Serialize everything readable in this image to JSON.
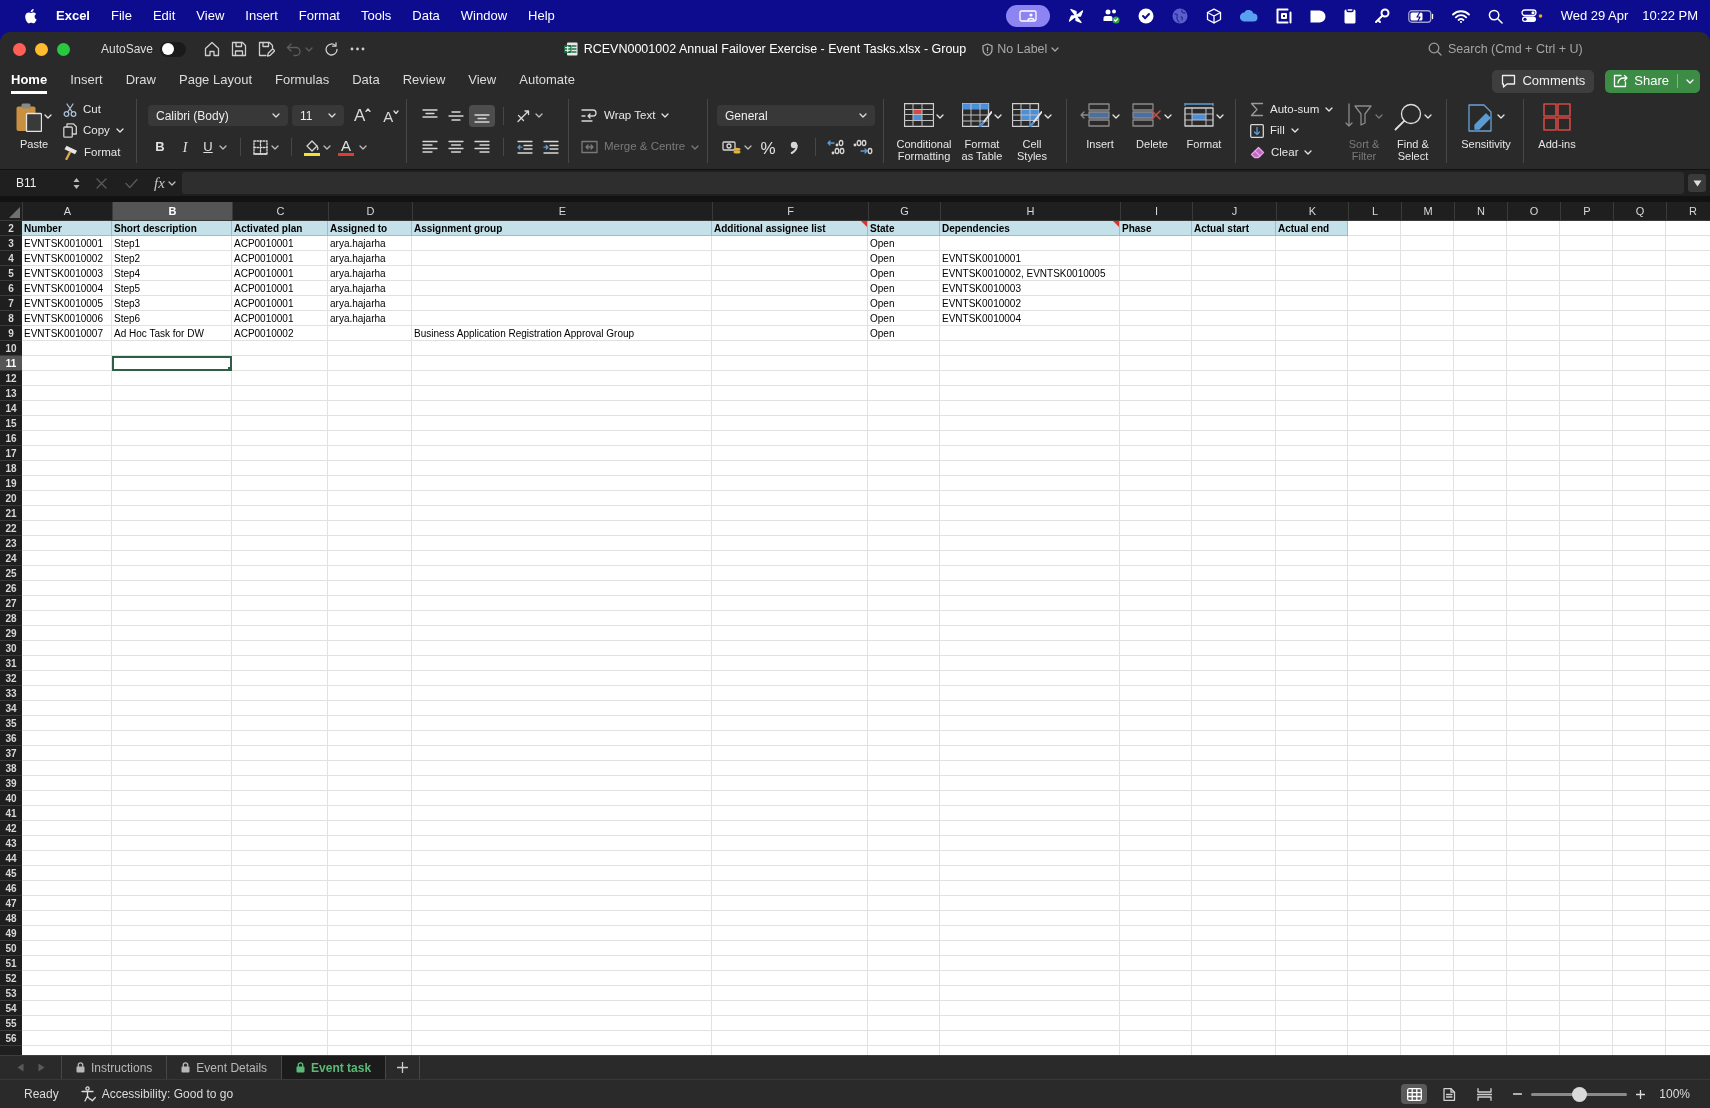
{
  "menu_bar": {
    "app_name": "Excel",
    "items": [
      "File",
      "Edit",
      "View",
      "Insert",
      "Format",
      "Tools",
      "Data",
      "Window",
      "Help"
    ],
    "date": "Wed 29 Apr",
    "time": "10:22 PM"
  },
  "title_bar": {
    "autosave": {
      "label": "AutoSave",
      "on": false
    },
    "undo_disabled": true,
    "document_title": "RCEVN0001002 Annual Failover Exercise - Event Tasks.xlsx - Group",
    "sensitivity_label": "No Label",
    "search": {
      "placeholder": "Search (Cmd + Ctrl + U)"
    }
  },
  "ribbon_tabs": [
    {
      "label": "Home",
      "selected": true
    },
    {
      "label": "Insert",
      "selected": false
    },
    {
      "label": "Draw",
      "selected": false
    },
    {
      "label": "Page Layout",
      "selected": false
    },
    {
      "label": "Formulas",
      "selected": false
    },
    {
      "label": "Data",
      "selected": false
    },
    {
      "label": "Review",
      "selected": false
    },
    {
      "label": "View",
      "selected": false
    },
    {
      "label": "Automate",
      "selected": false
    }
  ],
  "comments_button": "Comments",
  "share_button": "Share",
  "ribbon": {
    "clipboard": {
      "paste": "Paste",
      "cut": "Cut",
      "copy": "Copy",
      "format_painter": "Format"
    },
    "font": {
      "name": "Calibri (Body)",
      "size": "11",
      "grow": "A",
      "shrink": "A",
      "bold": "B",
      "italic": "I",
      "underline": "U",
      "font_color": "A"
    },
    "alignment": {
      "vertical": [
        {
          "kind": "top",
          "selected": false
        },
        {
          "kind": "middle",
          "selected": false
        },
        {
          "kind": "bottom",
          "selected": true
        }
      ],
      "wrap_text": "Wrap Text",
      "merge": {
        "label": "Merge & Centre",
        "disabled": true
      }
    },
    "number": {
      "format": "General",
      "percent": "%"
    },
    "styles": [
      {
        "kind": "conditional",
        "label": "Conditional\nFormatting"
      },
      {
        "kind": "table",
        "label": "Format\nas Table"
      },
      {
        "kind": "cell_styles",
        "label": "Cell\nStyles"
      }
    ],
    "cells": [
      {
        "kind": "insert",
        "label": "Insert"
      },
      {
        "kind": "delete",
        "label": "Delete"
      },
      {
        "kind": "format",
        "label": "Format"
      }
    ],
    "editing": {
      "auto_sum": "Auto-sum",
      "fill": "Fill",
      "clear": "Clear",
      "sort_filter": {
        "label": "Sort &\nFilter",
        "disabled": true
      },
      "find_select": "Find &\nSelect"
    },
    "sensitivity": "Sensitivity",
    "add_ins": "Add-ins"
  },
  "formula_bar": {
    "name_box": "B11",
    "edit_disabled": true,
    "function_label": "fx"
  },
  "sheet": {
    "columns": [
      {
        "label": "A",
        "selected": false
      },
      {
        "label": "B",
        "selected": true
      },
      {
        "label": "C",
        "selected": false
      },
      {
        "label": "D",
        "selected": false
      },
      {
        "label": "E",
        "selected": false
      },
      {
        "label": "F",
        "selected": false
      },
      {
        "label": "G",
        "selected": false
      },
      {
        "label": "H",
        "selected": false
      },
      {
        "label": "I",
        "selected": false
      },
      {
        "label": "J",
        "selected": false
      },
      {
        "label": "K",
        "selected": false
      },
      {
        "label": "L",
        "selected": false
      },
      {
        "label": "M",
        "selected": false
      },
      {
        "label": "N",
        "selected": false
      },
      {
        "label": "O",
        "selected": false
      },
      {
        "label": "P",
        "selected": false
      },
      {
        "label": "Q",
        "selected": false
      },
      {
        "label": "R",
        "selected": false
      }
    ],
    "rows": [
      {
        "label": "2",
        "selected": false,
        "kind": "header",
        "cells": [
          {
            "text": "Number",
            "comment": false
          },
          {
            "text": "Short description",
            "comment": false
          },
          {
            "text": "Activated plan",
            "comment": false
          },
          {
            "text": "Assigned to",
            "comment": false
          },
          {
            "text": "Assignment group",
            "comment": false
          },
          {
            "text": "Additional assignee list",
            "comment": true
          },
          {
            "text": "State",
            "comment": false
          },
          {
            "text": "Dependencies",
            "comment": true
          },
          {
            "text": "Phase",
            "comment": false
          },
          {
            "text": "Actual start",
            "comment": false
          },
          {
            "text": "Actual end",
            "comment": false
          }
        ]
      },
      {
        "label": "3",
        "selected": false,
        "kind": "data",
        "cells": [
          "EVNTSK0010001",
          "Step1",
          "ACP0010001",
          "arya.hajarha",
          null,
          null,
          "Open"
        ]
      },
      {
        "label": "4",
        "selected": false,
        "kind": "data",
        "cells": [
          "EVNTSK0010002",
          "Step2",
          "ACP0010001",
          "arya.hajarha",
          null,
          null,
          "Open",
          "EVNTSK0010001"
        ]
      },
      {
        "label": "5",
        "selected": false,
        "kind": "data",
        "cells": [
          "EVNTSK0010003",
          "Step4",
          "ACP0010001",
          "arya.hajarha",
          null,
          null,
          "Open",
          "EVNTSK0010002, EVNTSK0010005"
        ]
      },
      {
        "label": "6",
        "selected": false,
        "kind": "data",
        "cells": [
          "EVNTSK0010004",
          "Step5",
          "ACP0010001",
          "arya.hajarha",
          null,
          null,
          "Open",
          "EVNTSK0010003"
        ]
      },
      {
        "label": "7",
        "selected": false,
        "kind": "data",
        "cells": [
          "EVNTSK0010005",
          "Step3",
          "ACP0010001",
          "arya.hajarha",
          null,
          null,
          "Open",
          "EVNTSK0010002"
        ]
      },
      {
        "label": "8",
        "selected": false,
        "kind": "data",
        "cells": [
          "EVNTSK0010006",
          "Step6",
          "ACP0010001",
          "arya.hajarha",
          null,
          null,
          "Open",
          "EVNTSK0010004"
        ]
      },
      {
        "label": "9",
        "selected": false,
        "kind": "data",
        "cells": [
          "EVNTSK0010007",
          "Ad Hoc Task for DW",
          "ACP0010002",
          null,
          "Business Application Registration Approval Group",
          null,
          "Open"
        ]
      },
      {
        "label": "10",
        "selected": false,
        "kind": "data"
      },
      {
        "label": "11",
        "selected": true,
        "kind": "data"
      },
      {
        "label": "12",
        "selected": false,
        "kind": "data"
      },
      {
        "label": "13",
        "selected": false,
        "kind": "data"
      },
      {
        "label": "14",
        "selected": false,
        "kind": "data"
      },
      {
        "label": "15",
        "selected": false,
        "kind": "data"
      },
      {
        "label": "16",
        "selected": false,
        "kind": "data"
      },
      {
        "label": "17",
        "selected": false,
        "kind": "data"
      },
      {
        "label": "18",
        "selected": false,
        "kind": "data"
      },
      {
        "label": "19",
        "selected": false,
        "kind": "data"
      },
      {
        "label": "20",
        "selected": false,
        "kind": "data"
      },
      {
        "label": "21",
        "selected": false,
        "kind": "data"
      },
      {
        "label": "22",
        "selected": false,
        "kind": "data"
      },
      {
        "label": "23",
        "selected": false,
        "kind": "data"
      },
      {
        "label": "24",
        "selected": false,
        "kind": "data"
      },
      {
        "label": "25",
        "selected": false,
        "kind": "data"
      },
      {
        "label": "26",
        "selected": false,
        "kind": "data"
      },
      {
        "label": "27",
        "selected": false,
        "kind": "data"
      },
      {
        "label": "28",
        "selected": false,
        "kind": "data"
      },
      {
        "label": "29",
        "selected": false,
        "kind": "data"
      },
      {
        "label": "30",
        "selected": false,
        "kind": "data"
      },
      {
        "label": "31",
        "selected": false,
        "kind": "data"
      },
      {
        "label": "32",
        "selected": false,
        "kind": "data"
      },
      {
        "label": "33",
        "selected": false,
        "kind": "data"
      },
      {
        "label": "34",
        "selected": false,
        "kind": "data"
      },
      {
        "label": "35",
        "selected": false,
        "kind": "data"
      },
      {
        "label": "36",
        "selected": false,
        "kind": "data"
      },
      {
        "label": "37",
        "selected": false,
        "kind": "data"
      },
      {
        "label": "38",
        "selected": false,
        "kind": "data"
      },
      {
        "label": "39",
        "selected": false,
        "kind": "data"
      },
      {
        "label": "40",
        "selected": false,
        "kind": "data"
      },
      {
        "label": "41",
        "selected": false,
        "kind": "data"
      },
      {
        "label": "42",
        "selected": false,
        "kind": "data"
      },
      {
        "label": "43",
        "selected": false,
        "kind": "data"
      },
      {
        "label": "44",
        "selected": false,
        "kind": "data"
      },
      {
        "label": "45",
        "selected": false,
        "kind": "data"
      },
      {
        "label": "46",
        "selected": false,
        "kind": "data"
      },
      {
        "label": "47",
        "selected": false,
        "kind": "data"
      },
      {
        "label": "48",
        "selected": false,
        "kind": "data"
      },
      {
        "label": "49",
        "selected": false,
        "kind": "data"
      },
      {
        "label": "50",
        "selected": false,
        "kind": "data"
      },
      {
        "label": "51",
        "selected": false,
        "kind": "data"
      },
      {
        "label": "52",
        "selected": false,
        "kind": "data"
      },
      {
        "label": "53",
        "selected": false,
        "kind": "data"
      },
      {
        "label": "54",
        "selected": false,
        "kind": "data"
      },
      {
        "label": "55",
        "selected": false,
        "kind": "data"
      },
      {
        "label": "56",
        "selected": false,
        "kind": "data"
      }
    ]
  },
  "sheet_nav_disabled": true,
  "sheet_tabs": [
    {
      "label": "Instructions",
      "selected": false
    },
    {
      "label": "Event Details",
      "selected": false
    },
    {
      "label": "Event task",
      "selected": true
    }
  ],
  "status_bar": {
    "status": "Ready",
    "accessibility": "Accessibility: Good to go",
    "views": [
      {
        "kind": "normal",
        "selected": true
      },
      {
        "kind": "page_layout",
        "selected": false
      },
      {
        "kind": "page_break",
        "selected": false
      }
    ],
    "zoom": {
      "level": 0.5,
      "reading": "100%"
    }
  }
}
